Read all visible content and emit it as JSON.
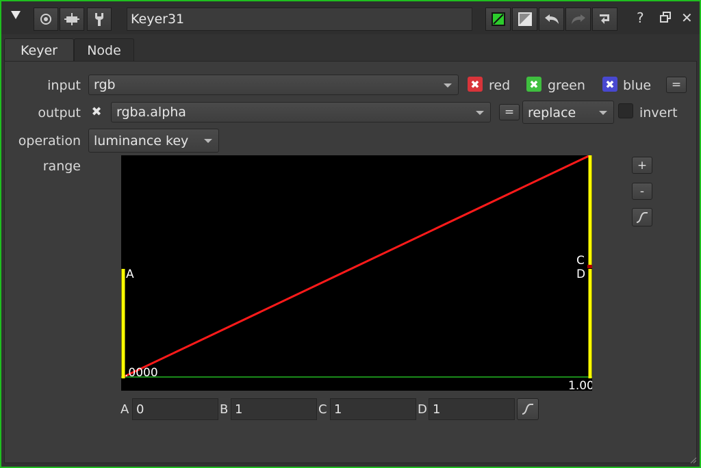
{
  "title_bar": {
    "node_name": "Keyer31"
  },
  "tabs": [
    {
      "label": "Keyer"
    },
    {
      "label": "Node"
    }
  ],
  "input": {
    "label": "input",
    "value": "rgb",
    "channels": [
      {
        "label": "red",
        "color": "#d8343a"
      },
      {
        "label": "green",
        "color": "#3fbf3f"
      },
      {
        "label": "blue",
        "color": "#4848d0"
      }
    ],
    "equals": "="
  },
  "output": {
    "label": "output",
    "value": "rgba.alpha",
    "equals": "=",
    "mode": "replace",
    "invert_label": "invert"
  },
  "operation": {
    "label": "operation",
    "value": "luminance key"
  },
  "range": {
    "label": "range",
    "graph": {
      "marker_a": "A",
      "marker_c": "C",
      "marker_d": "D",
      "left_value": ".0000",
      "right_value": "1.00",
      "curve_color": "#ff1a1a",
      "handle_color": "#ffff00",
      "baseline_color": "#1a8a1a"
    },
    "side_buttons": {
      "plus": "+",
      "minus": "-"
    }
  },
  "fields": [
    {
      "label": "A",
      "value": "0"
    },
    {
      "label": "B",
      "value": "1"
    },
    {
      "label": "C",
      "value": "1"
    },
    {
      "label": "D",
      "value": "1"
    }
  ],
  "colors": {
    "accent": "#1fbf1f"
  }
}
